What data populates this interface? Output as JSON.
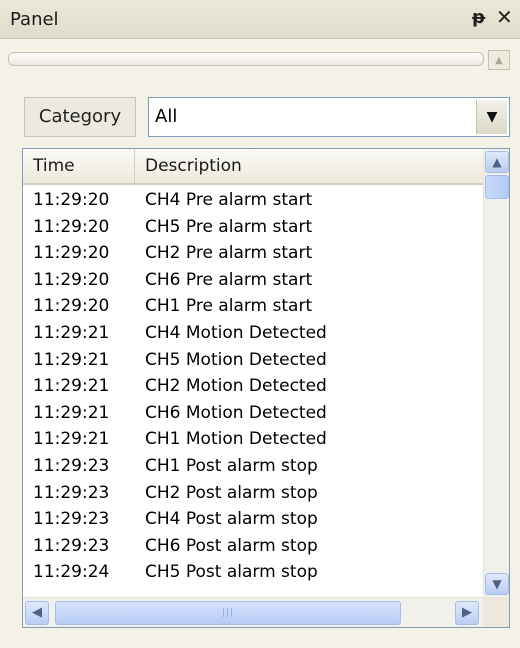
{
  "panel": {
    "title": "Panel"
  },
  "icons": {
    "pin": "pin-icon",
    "close": "close-icon",
    "dropdown": "chevron-down-icon"
  },
  "filter": {
    "label": "Category",
    "value": "All"
  },
  "table": {
    "columns": [
      "Time",
      "Description"
    ],
    "rows": [
      {
        "time": "11:29:20",
        "desc": "CH4 Pre alarm start"
      },
      {
        "time": "11:29:20",
        "desc": "CH5 Pre alarm start"
      },
      {
        "time": "11:29:20",
        "desc": "CH2 Pre alarm start"
      },
      {
        "time": "11:29:20",
        "desc": "CH6 Pre alarm start"
      },
      {
        "time": "11:29:20",
        "desc": "CH1 Pre alarm start"
      },
      {
        "time": "11:29:21",
        "desc": "CH4 Motion Detected"
      },
      {
        "time": "11:29:21",
        "desc": "CH5 Motion Detected"
      },
      {
        "time": "11:29:21",
        "desc": "CH2 Motion Detected"
      },
      {
        "time": "11:29:21",
        "desc": "CH6 Motion Detected"
      },
      {
        "time": "11:29:21",
        "desc": "CH1 Motion Detected"
      },
      {
        "time": "11:29:23",
        "desc": "CH1 Post alarm stop"
      },
      {
        "time": "11:29:23",
        "desc": "CH2 Post alarm stop"
      },
      {
        "time": "11:29:23",
        "desc": "CH4 Post alarm stop"
      },
      {
        "time": "11:29:23",
        "desc": "CH6 Post alarm stop"
      },
      {
        "time": "11:29:24",
        "desc": "CH5 Post alarm stop"
      }
    ]
  }
}
